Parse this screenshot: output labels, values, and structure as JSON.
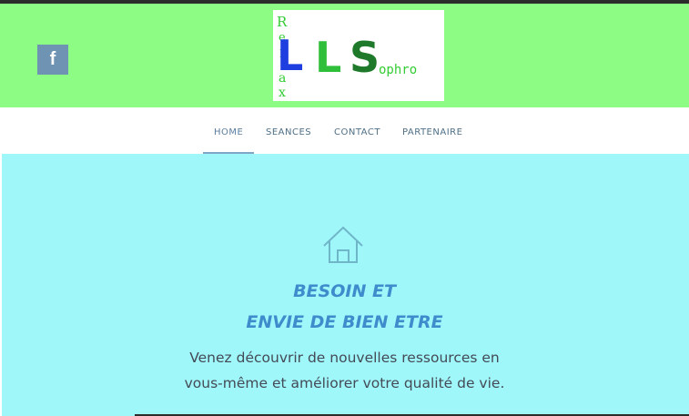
{
  "header": {
    "social": {
      "icon": "facebook-icon",
      "glyph": "f"
    },
    "logo": {
      "vertical_letters": [
        "R",
        "e",
        "l",
        "a",
        "x"
      ],
      "main_letters": [
        "L",
        "L",
        "S"
      ],
      "suffix": "ophro",
      "colors": {
        "first_l": "#1f3ee0",
        "second_l": "#2fbf3a",
        "s": "#1e7a2a",
        "script": "#33cc33"
      }
    }
  },
  "nav": {
    "items": [
      {
        "label": "HOME",
        "active": true
      },
      {
        "label": "SEANCES",
        "active": false
      },
      {
        "label": "CONTACT",
        "active": false
      },
      {
        "label": "PARTENAIRE",
        "active": false
      }
    ]
  },
  "hero": {
    "icon": "home-icon",
    "title_line1": "BESOIN ET",
    "title_line2": "ENVIE DE BIEN ETRE",
    "text_line1": "Venez découvrir de nouvelles ressources en",
    "text_line2": "vous-même et améliorer votre qualité de vie."
  },
  "colors": {
    "header_bg": "#8dfc85",
    "hero_bg": "#a0f7fa",
    "title": "#3f8ccc",
    "nav_text": "#4f6f86",
    "facebook_bg": "#6e93b3"
  }
}
